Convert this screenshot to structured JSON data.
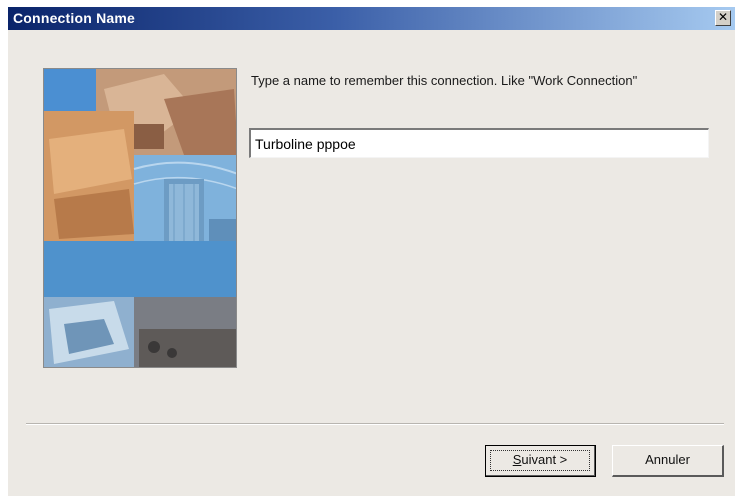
{
  "window": {
    "title": "Connection Name",
    "close_glyph": "✕"
  },
  "wizard": {
    "prompt": "Type a name to remember this connection.  Like \"Work Connection\"",
    "connection_name_value": "Turboline pppoe",
    "illustration_icon": "office-collage-illustration"
  },
  "buttons": {
    "next_mnemonic": "S",
    "next_rest": "uivant >",
    "cancel_label": "Annuler"
  },
  "colors": {
    "titlebar_start": "#0a246a",
    "titlebar_end": "#a6caf0",
    "dialog_background": "#ece9e4"
  }
}
